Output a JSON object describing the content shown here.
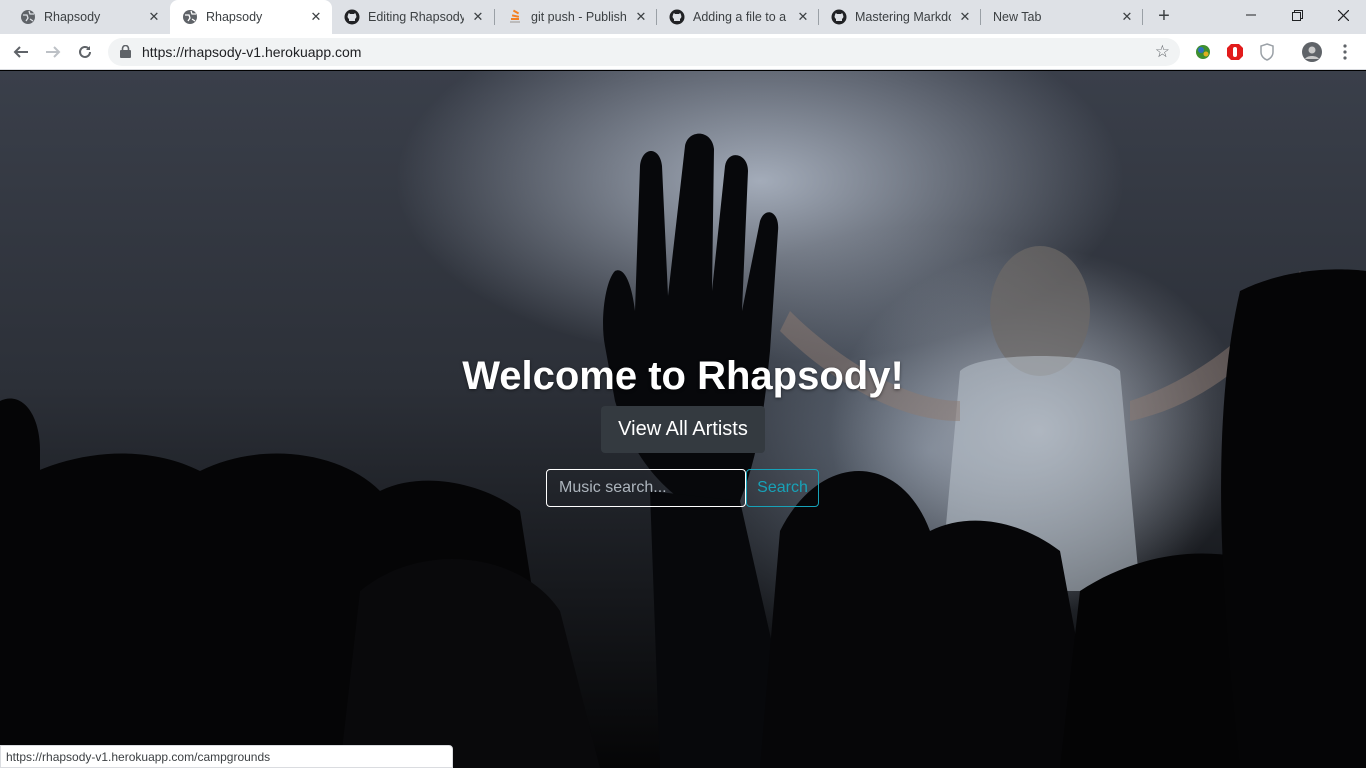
{
  "browser": {
    "tabs": [
      {
        "title": "Rhapsody",
        "icon": "globe-icon",
        "active": false
      },
      {
        "title": "Rhapsody",
        "icon": "globe-icon",
        "active": true
      },
      {
        "title": "Editing Rhapsody/",
        "icon": "github-icon",
        "active": false
      },
      {
        "title": "git push - Publishi",
        "icon": "stackoverflow-icon",
        "active": false
      },
      {
        "title": "Adding a file to a",
        "icon": "github-icon",
        "active": false
      },
      {
        "title": "Mastering Markdo",
        "icon": "github-icon",
        "active": false
      },
      {
        "title": "New Tab",
        "icon": "none",
        "active": false
      }
    ],
    "url": "https://rhapsody-v1.herokuapp.com",
    "status_url": "https://rhapsody-v1.herokuapp.com/campgrounds"
  },
  "page": {
    "heading": "Welcome to Rhapsody!",
    "view_artists_label": "View All Artists",
    "search_placeholder": "Music search...",
    "search_label": "Search"
  },
  "colors": {
    "search_accent": "#17a2b8",
    "dark_button": "#343a40"
  }
}
